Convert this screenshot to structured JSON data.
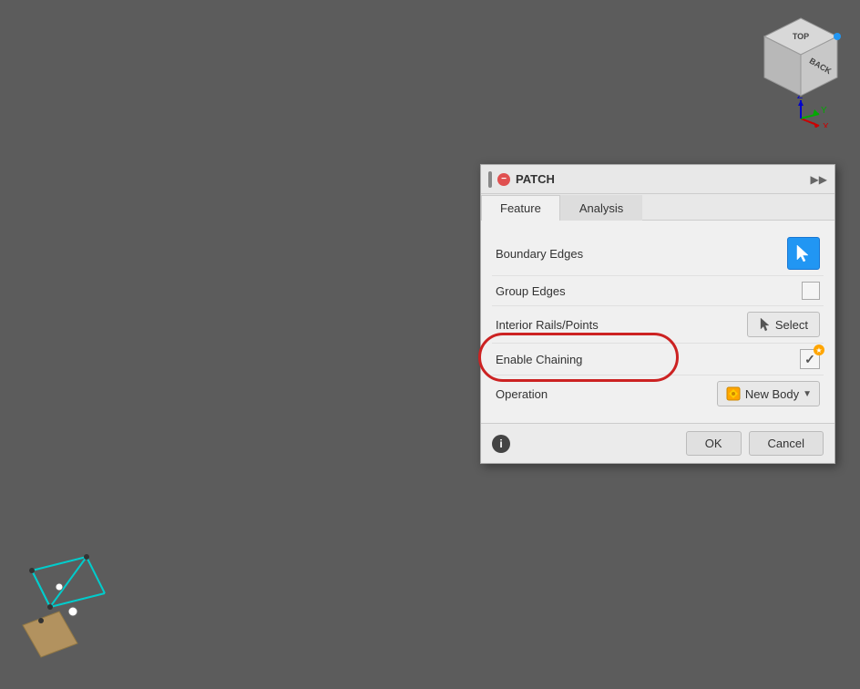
{
  "viewport": {
    "background_color": "#5c5c5c"
  },
  "dialog": {
    "title": "PATCH",
    "tabs": [
      {
        "label": "Feature",
        "active": true
      },
      {
        "label": "Analysis",
        "active": false
      }
    ],
    "rows": [
      {
        "label": "Boundary Edges",
        "control_type": "blue_button",
        "control_label": ""
      },
      {
        "label": "Group Edges",
        "control_type": "checkbox",
        "checked": false
      },
      {
        "label": "Interior Rails/Points",
        "control_type": "select_button",
        "control_label": "Select"
      },
      {
        "label": "Enable Chaining",
        "control_type": "checked_checkbox",
        "checked": true,
        "highlighted": true
      },
      {
        "label": "Operation",
        "control_type": "dropdown",
        "control_label": "New Body"
      }
    ],
    "footer": {
      "info_icon": "i",
      "ok_label": "OK",
      "cancel_label": "Cancel"
    }
  }
}
